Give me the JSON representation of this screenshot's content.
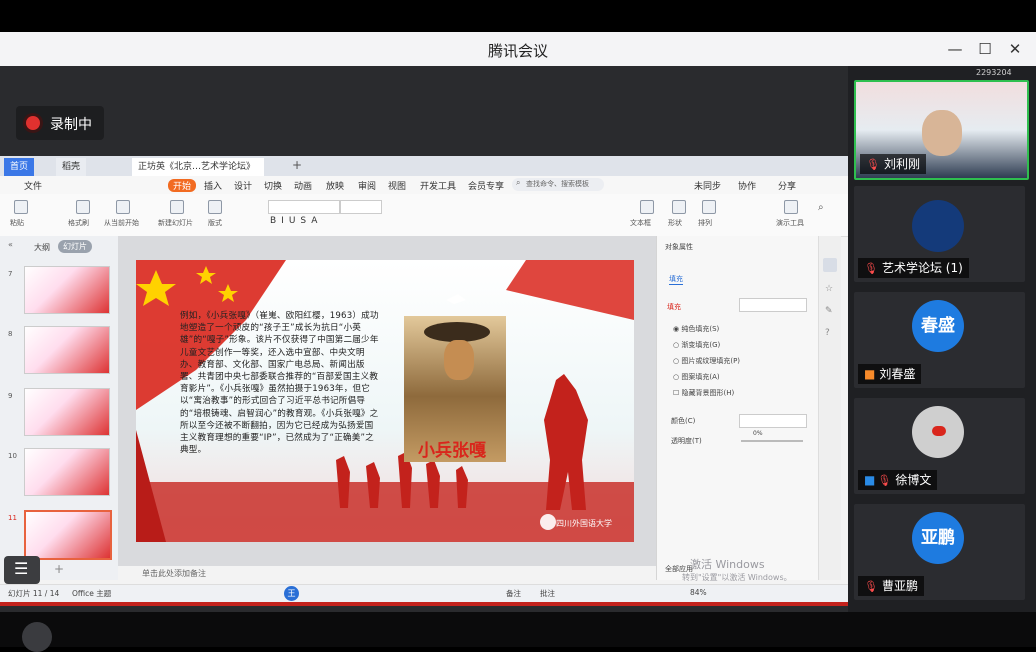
{
  "window": {
    "title": "腾讯会议",
    "meeting_id": "2293204"
  },
  "recording": {
    "label": "录制中"
  },
  "wps": {
    "tabs": [
      {
        "label": "首页"
      },
      {
        "label": "稻壳"
      },
      {
        "label": "正坊英《北京…艺术学论坛》"
      }
    ],
    "menus": [
      "文件",
      "开始",
      "插入",
      "设计",
      "切换",
      "动画",
      "放映",
      "审阅",
      "视图",
      "开发工具",
      "会员专享"
    ],
    "search_placeholder": "查找命令、搜索模板",
    "menu_right": [
      "未同步",
      "协作",
      "分享"
    ],
    "toolbar_labels": [
      "粘贴",
      "格式刷",
      "从当前开始",
      "新建幻灯片",
      "版式",
      "节",
      "重置",
      "文本框",
      "形状",
      "排列",
      "演示工具",
      "查找"
    ],
    "panel_tabs": [
      "大纲",
      "幻灯片"
    ],
    "thumbnail_numbers": [
      "7",
      "8",
      "9",
      "10",
      "11"
    ],
    "slide": {
      "body_text": "例如，《小兵张嘎》（崔嵬、欧阳红樱，1963）成功地塑造了一个顽皮的“孩子王”成长为抗日“小英雄”的“嘎子”形象。该片不仅获得了中国第二届少年儿童文艺创作一等奖，还入选中宣部、中央文明办、教育部、文化部、国家广电总局、新闻出版署、共青团中央七部委联合推荐的“百部爱国主义教育影片”。《小兵张嘎》虽然拍摄于1963年，但它以“寓治教事”的形式回合了习近平总书记所倡导的“培根铸魂、启智润心”的教育观。《小兵张嘎》之所以至今还被不断翻拍，因为它已经成为弘扬爱国主义教育理想的重要“IP”，已然成为了“正确美”之典型。",
      "poster_title": "小兵张嘎",
      "university": "四川外国语大学"
    },
    "properties": {
      "title": "对象属性",
      "tab": "填充",
      "section": "填充",
      "options": [
        "纯色填充(S)",
        "渐变填充(G)",
        "图片或纹理填充(P)",
        "图案填充(A)",
        "隐藏背景图形(H)"
      ],
      "color_label": "颜色(C)",
      "transparency_label": "透明度(T)",
      "transparency_value": "0%",
      "apply_all": "全部应用"
    },
    "notes_placeholder": "单击此处添加备注",
    "status": {
      "slide_counter": "幻灯片 11 / 14",
      "theme": "Office 主题",
      "notes_btn": "备注",
      "comments_btn": "批注",
      "zoom": "84%"
    },
    "watermark": [
      "激活 Windows",
      "转到\"设置\"以激活 Windows。"
    ]
  },
  "participants": [
    {
      "name": "刘利刚",
      "type": "video"
    },
    {
      "name": "艺术学论坛 (1)",
      "type": "logo"
    },
    {
      "name": "刘春盛",
      "type": "avatar",
      "avatar_text": "春盛"
    },
    {
      "name": "徐博文",
      "type": "photo"
    },
    {
      "name": "曹亚鹏",
      "type": "avatar",
      "avatar_text": "亚鹏"
    }
  ],
  "colors": {
    "accent_red": "#d9261c",
    "avatar_blue": "#1e7be0",
    "recording_red": "#e0312f"
  }
}
